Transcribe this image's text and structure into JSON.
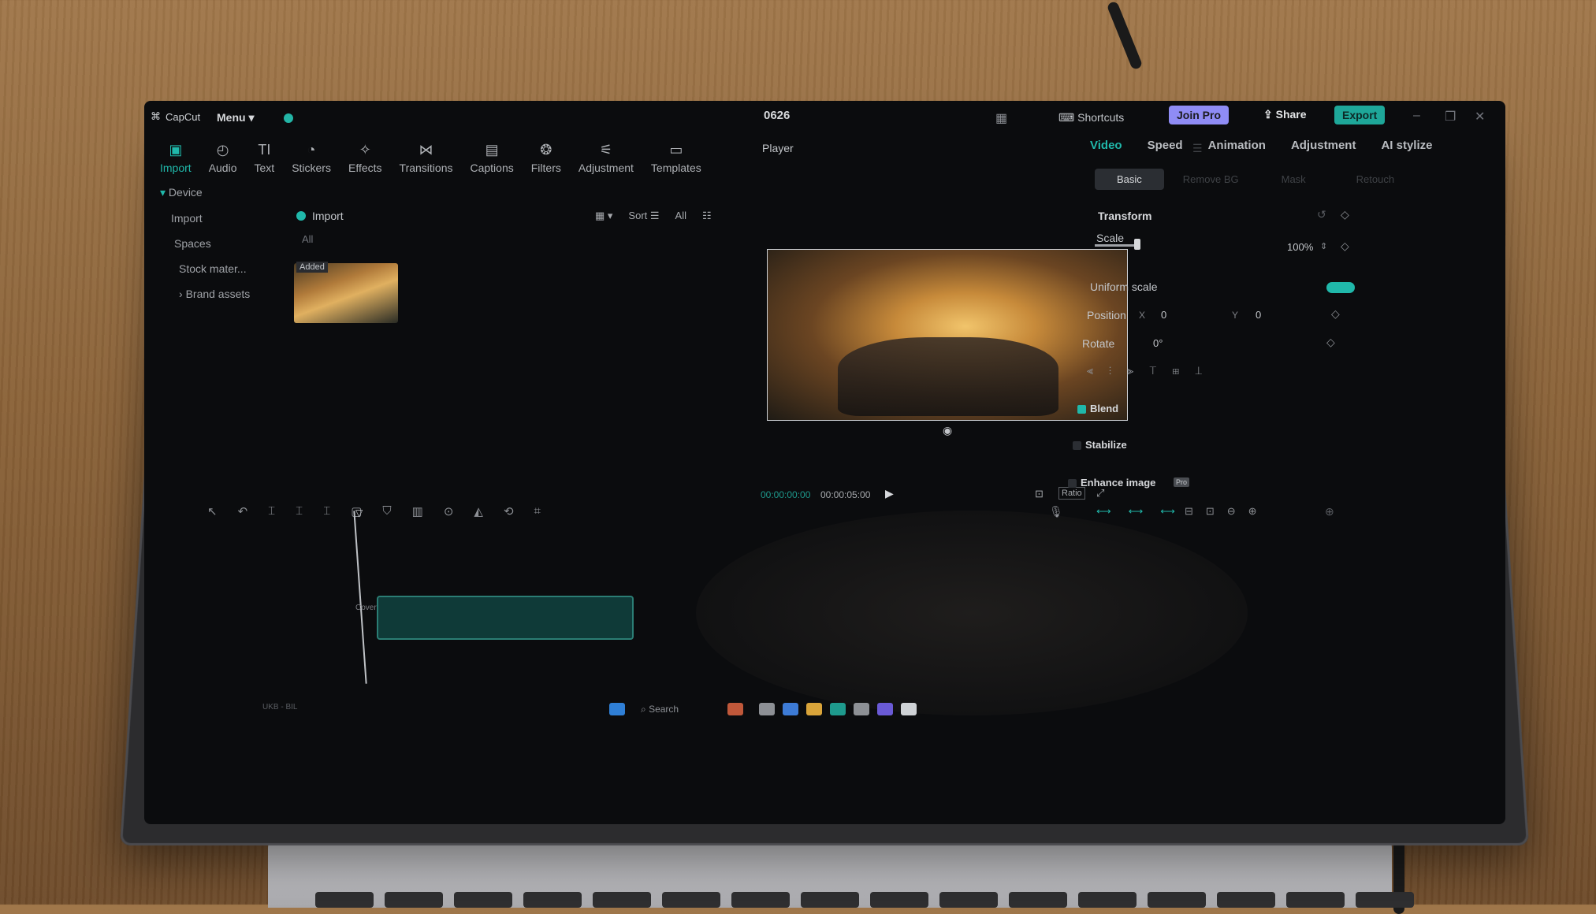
{
  "app": {
    "brand": "CapCut",
    "menu_label": "Menu",
    "project_title": "0626",
    "shortcuts_label": "Shortcuts",
    "join_pro_label": "Join Pro",
    "share_label": "Share",
    "export_label": "Export"
  },
  "toolbar": {
    "items": [
      {
        "label": "Import",
        "icon": "import-icon",
        "active": true
      },
      {
        "label": "Audio",
        "icon": "audio-icon"
      },
      {
        "label": "Text",
        "icon": "text-icon"
      },
      {
        "label": "Stickers",
        "icon": "stickers-icon"
      },
      {
        "label": "Effects",
        "icon": "effects-icon"
      },
      {
        "label": "Transitions",
        "icon": "transitions-icon"
      },
      {
        "label": "Captions",
        "icon": "captions-icon"
      },
      {
        "label": "Filters",
        "icon": "filters-icon"
      },
      {
        "label": "Adjustment",
        "icon": "adjustment-icon"
      },
      {
        "label": "Templates",
        "icon": "templates-icon"
      }
    ]
  },
  "sidebar": {
    "items": [
      "Device",
      "Import",
      "Spaces",
      "Stock mater...",
      "Brand assets"
    ]
  },
  "media": {
    "import_label": "Import",
    "filter_all": "All",
    "sort_label": "Sort",
    "all_label": "All",
    "thumb_badge": "Added"
  },
  "player": {
    "label": "Player",
    "current_time": "00:00:00:00",
    "total_time": "00:00:05:00",
    "ratio_label": "Ratio"
  },
  "inspector": {
    "tabs": [
      "Video",
      "Speed",
      "Animation",
      "Adjustment",
      "AI stylize"
    ],
    "subtabs": [
      "Basic",
      "Remove BG",
      "Mask",
      "Retouch"
    ],
    "transform_label": "Transform",
    "scale_label": "Scale",
    "scale_value": "100%",
    "uniform_scale_label": "Uniform scale",
    "position_label": "Position",
    "pos_x_label": "X",
    "pos_x": "0",
    "pos_y_label": "Y",
    "pos_y": "0",
    "rotate_label": "Rotate",
    "rotate_value": "0°",
    "blend_label": "Blend",
    "stabilize_label": "Stabilize",
    "enhance_label": "Enhance image",
    "enhance_badge": "Pro"
  },
  "timeline": {
    "cover_label": "Cover"
  },
  "taskbar": {
    "search_label": "Search",
    "weather": "UKB - BIL"
  }
}
